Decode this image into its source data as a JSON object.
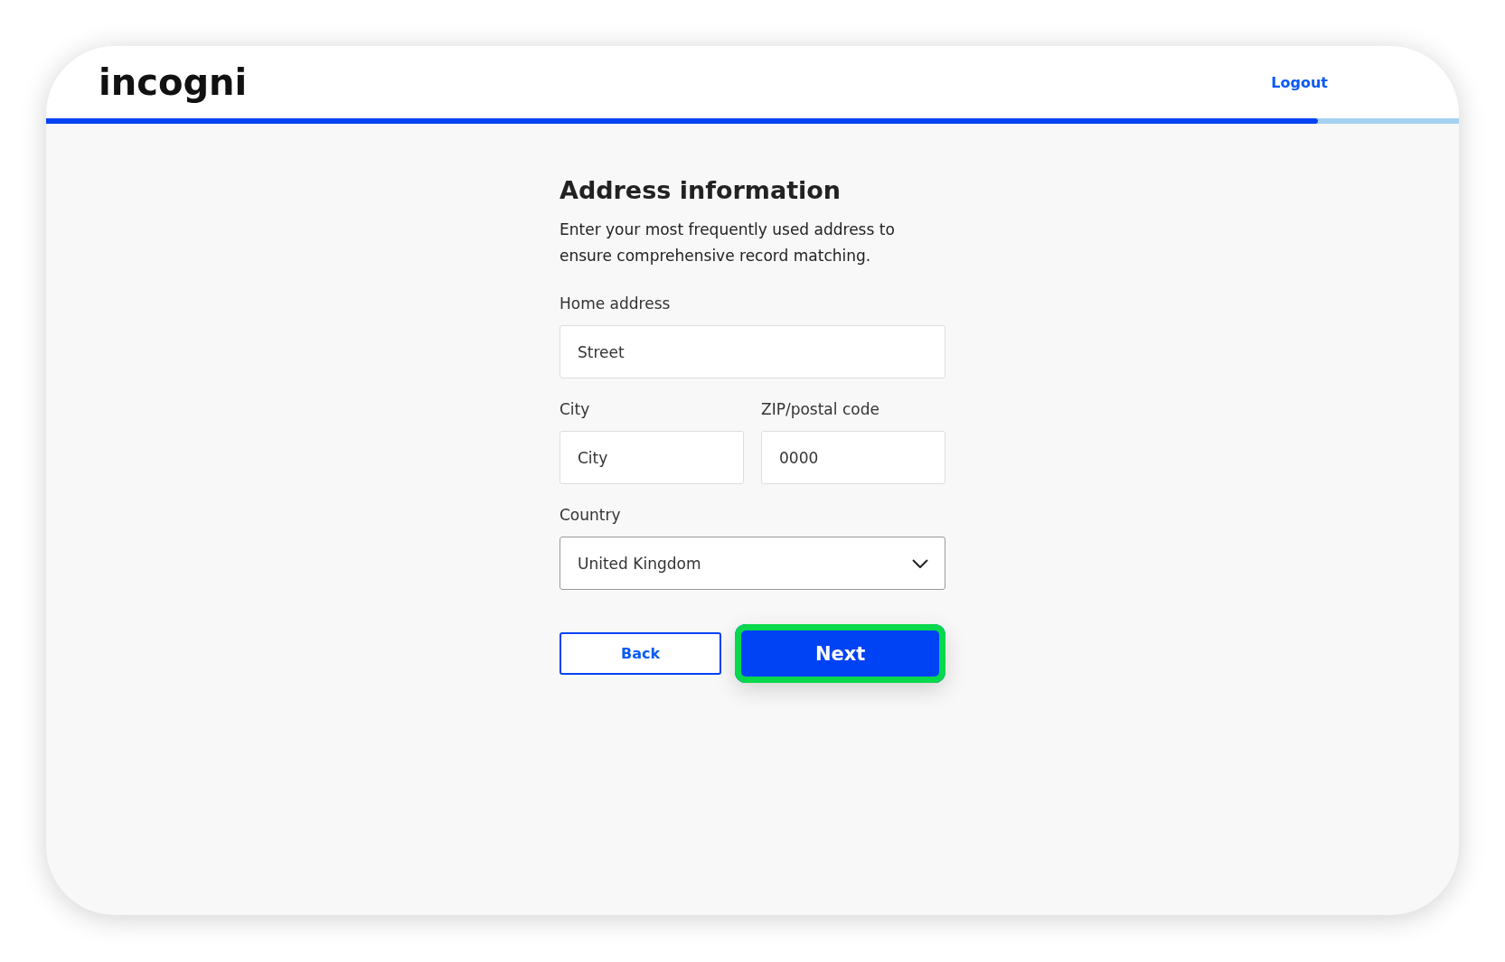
{
  "header": {
    "logo": "incogni",
    "logout": "Logout"
  },
  "progress": {
    "level": 0.9
  },
  "form": {
    "title": "Address information",
    "description": "Enter your most frequently used address to ensure comprehensive record matching.",
    "home_address": {
      "label": "Home address",
      "placeholder": "Street"
    },
    "city": {
      "label": "City",
      "placeholder": "City"
    },
    "zip": {
      "label": "ZIP/postal code",
      "placeholder": "0000"
    },
    "country": {
      "label": "Country",
      "value": "United Kingdom"
    }
  },
  "buttons": [
    {
      "kind": "secondary",
      "label": "Back",
      "highlighted": false
    },
    {
      "kind": "primary",
      "label": "Next",
      "highlighted": true
    }
  ]
}
